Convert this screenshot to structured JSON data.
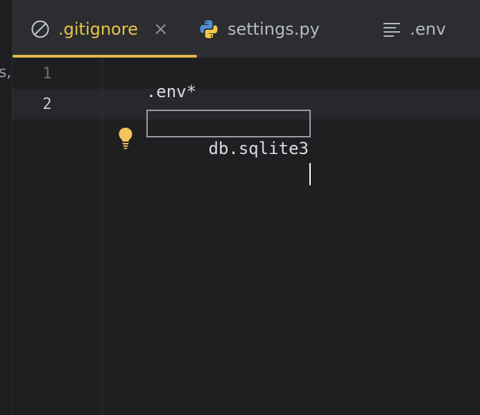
{
  "left_panel": {
    "clipped_text": "s,"
  },
  "tabs": [
    {
      "label": ".gitignore",
      "icon": "ignore-icon",
      "closable": true,
      "active": true
    },
    {
      "label": "settings.py",
      "icon": "python-icon",
      "closable": false,
      "active": false
    },
    {
      "label": ".env",
      "icon": "text-file-icon",
      "closable": false,
      "active": false
    }
  ],
  "tab_close_glyph": "×",
  "editor": {
    "lines": [
      {
        "number": "1",
        "text": ".env*"
      },
      {
        "number": "2",
        "text": "db.sqlite3"
      }
    ],
    "intention_icon": "lightbulb-icon"
  },
  "colors": {
    "active_tab_text": "#e7c547",
    "tab_underline": "#e0b84a",
    "background": "#1f1f22",
    "bulb": "#f2c55c"
  }
}
